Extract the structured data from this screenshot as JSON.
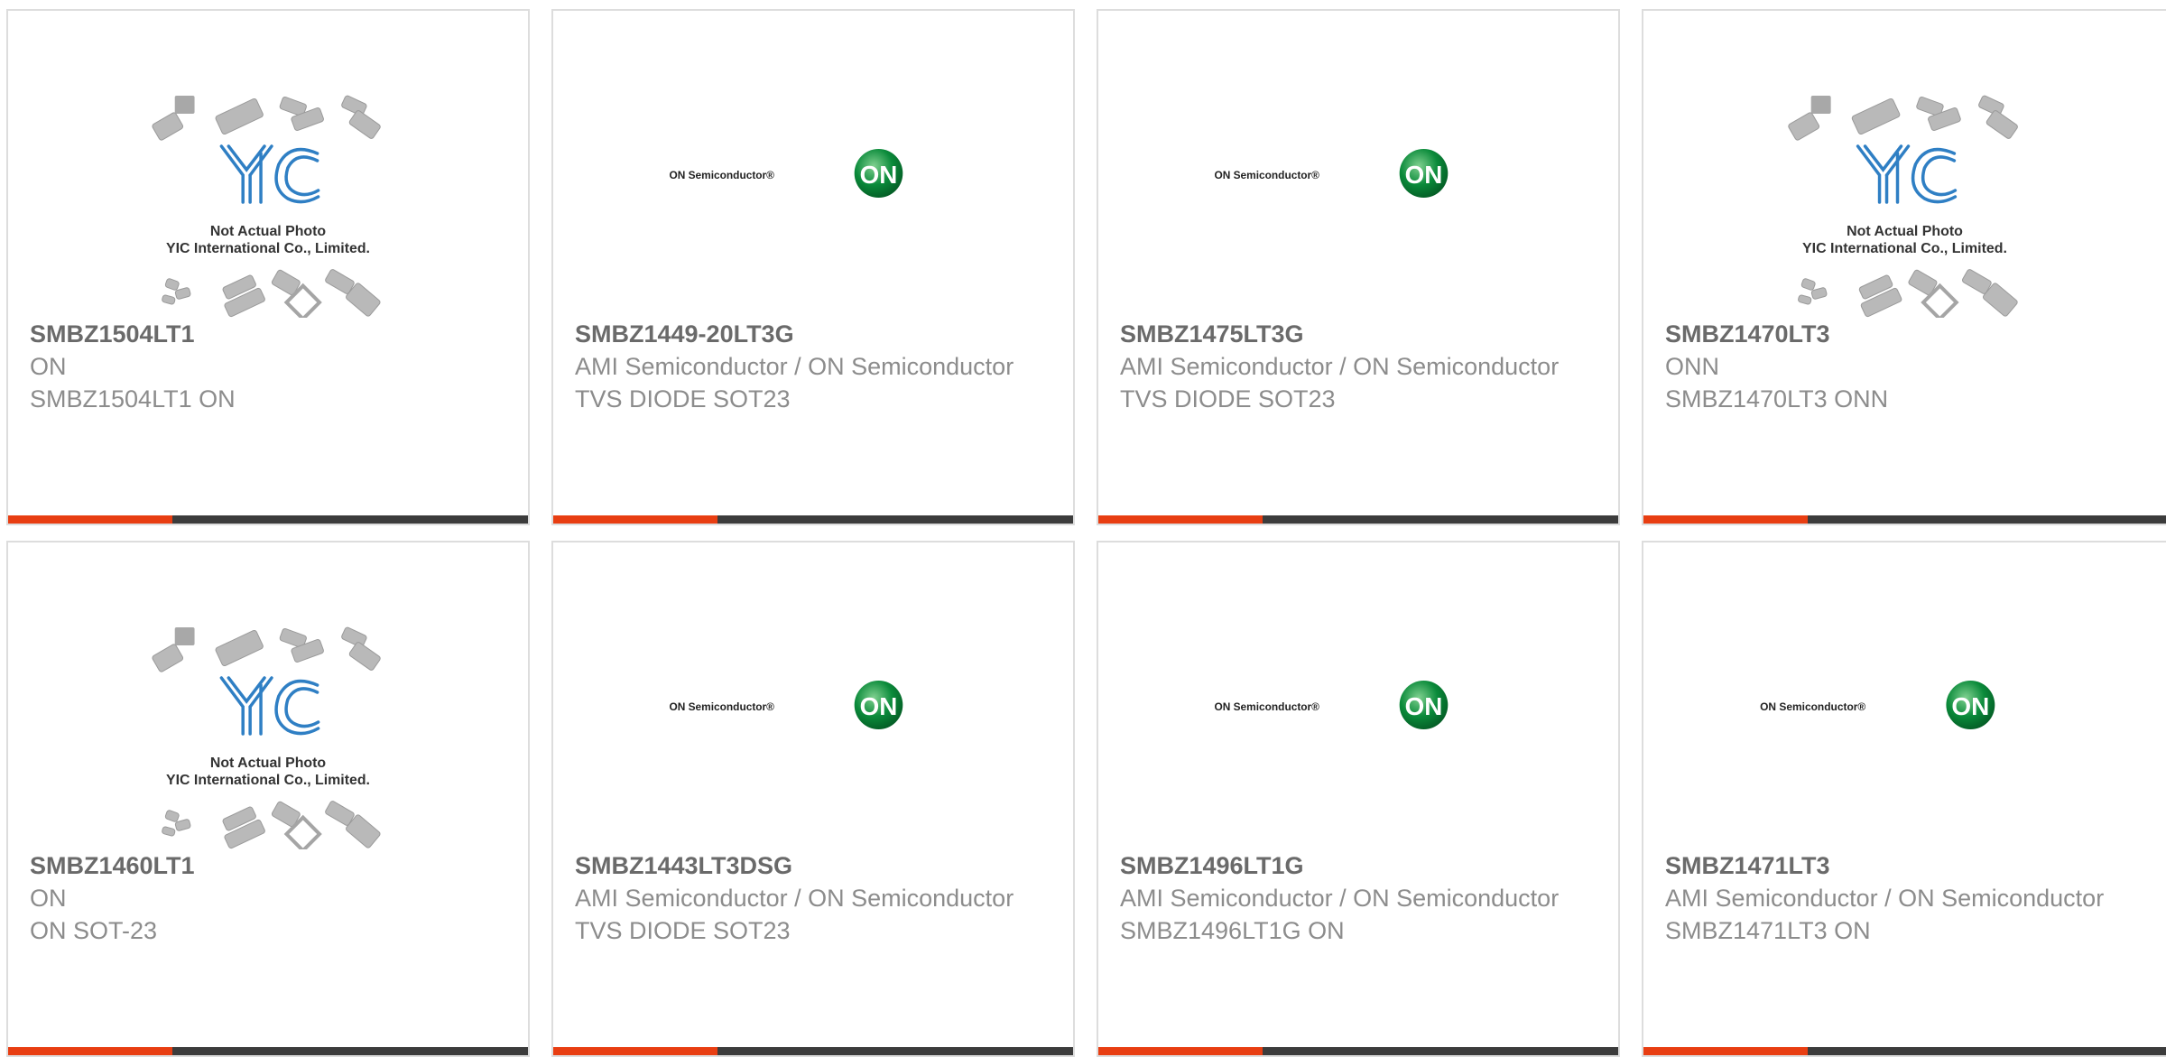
{
  "colors": {
    "accent_bar": "#e83e12",
    "dark_bar": "#3c3c3c",
    "on_logo_green": "#0a8a3a",
    "yic_logo_blue": "#2f7fc4",
    "text_title": "#6a6a6a",
    "text_body": "#8c8c8c"
  },
  "products": [
    {
      "part_number": "SMBZ1504LT1",
      "manufacturer": "ON",
      "description": "SMBZ1504LT1 ON",
      "image": {
        "type": "yic-placeholder",
        "line1": "Not Actual Photo",
        "line2": "YIC International Co., Limited."
      }
    },
    {
      "part_number": "SMBZ1449-20LT3G",
      "manufacturer": "AMI Semiconductor / ON Semiconductor",
      "description": "TVS DIODE SOT23",
      "image": {
        "type": "on-semi-logo",
        "wordmark": "ON Semiconductor",
        "badge": "ON"
      }
    },
    {
      "part_number": "SMBZ1475LT3G",
      "manufacturer": "AMI Semiconductor / ON Semiconductor",
      "description": "TVS DIODE SOT23",
      "image": {
        "type": "on-semi-logo",
        "wordmark": "ON Semiconductor",
        "badge": "ON"
      }
    },
    {
      "part_number": "SMBZ1470LT3",
      "manufacturer": "ONN",
      "description": "SMBZ1470LT3 ONN",
      "image": {
        "type": "yic-placeholder",
        "line1": "Not Actual Photo",
        "line2": "YIC International Co., Limited."
      }
    },
    {
      "part_number": "SMBZ1460LT1",
      "manufacturer": "ON",
      "description": "ON SOT-23",
      "image": {
        "type": "yic-placeholder",
        "line1": "Not Actual Photo",
        "line2": "YIC International Co., Limited."
      }
    },
    {
      "part_number": "SMBZ1443LT3DSG",
      "manufacturer": "AMI Semiconductor / ON Semiconductor",
      "description": "TVS DIODE SOT23",
      "image": {
        "type": "on-semi-logo",
        "wordmark": "ON Semiconductor",
        "badge": "ON"
      }
    },
    {
      "part_number": "SMBZ1496LT1G",
      "manufacturer": "AMI Semiconductor / ON Semiconductor",
      "description": "SMBZ1496LT1G ON",
      "image": {
        "type": "on-semi-logo",
        "wordmark": "ON Semiconductor",
        "badge": "ON"
      }
    },
    {
      "part_number": "SMBZ1471LT3",
      "manufacturer": "AMI Semiconductor / ON Semiconductor",
      "description": "SMBZ1471LT3 ON",
      "image": {
        "type": "on-semi-logo",
        "wordmark": "ON Semiconductor",
        "badge": "ON"
      }
    }
  ]
}
